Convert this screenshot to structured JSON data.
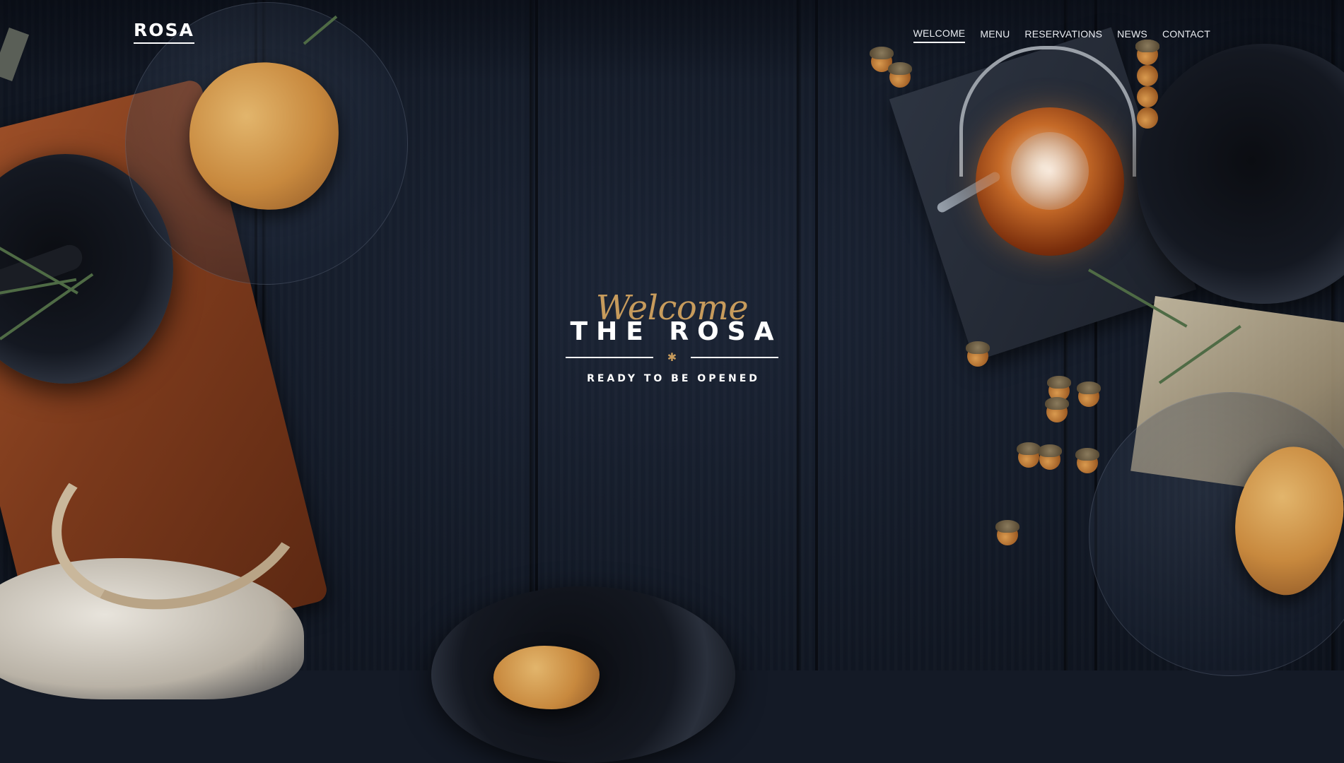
{
  "brand": {
    "logo": "ROSA"
  },
  "nav": {
    "items": [
      {
        "label": "WELCOME",
        "active": true
      },
      {
        "label": "MENU"
      },
      {
        "label": "RESERVATIONS"
      },
      {
        "label": "NEWS"
      },
      {
        "label": "CONTACT"
      }
    ]
  },
  "hero": {
    "script": "Welcome",
    "title": "THE ROSA",
    "star": "✱",
    "subtitle": "READY TO BE OPENED"
  },
  "colors": {
    "accent_gold": "#c79b5c",
    "background": "#141a26",
    "text": "#ffffff"
  }
}
